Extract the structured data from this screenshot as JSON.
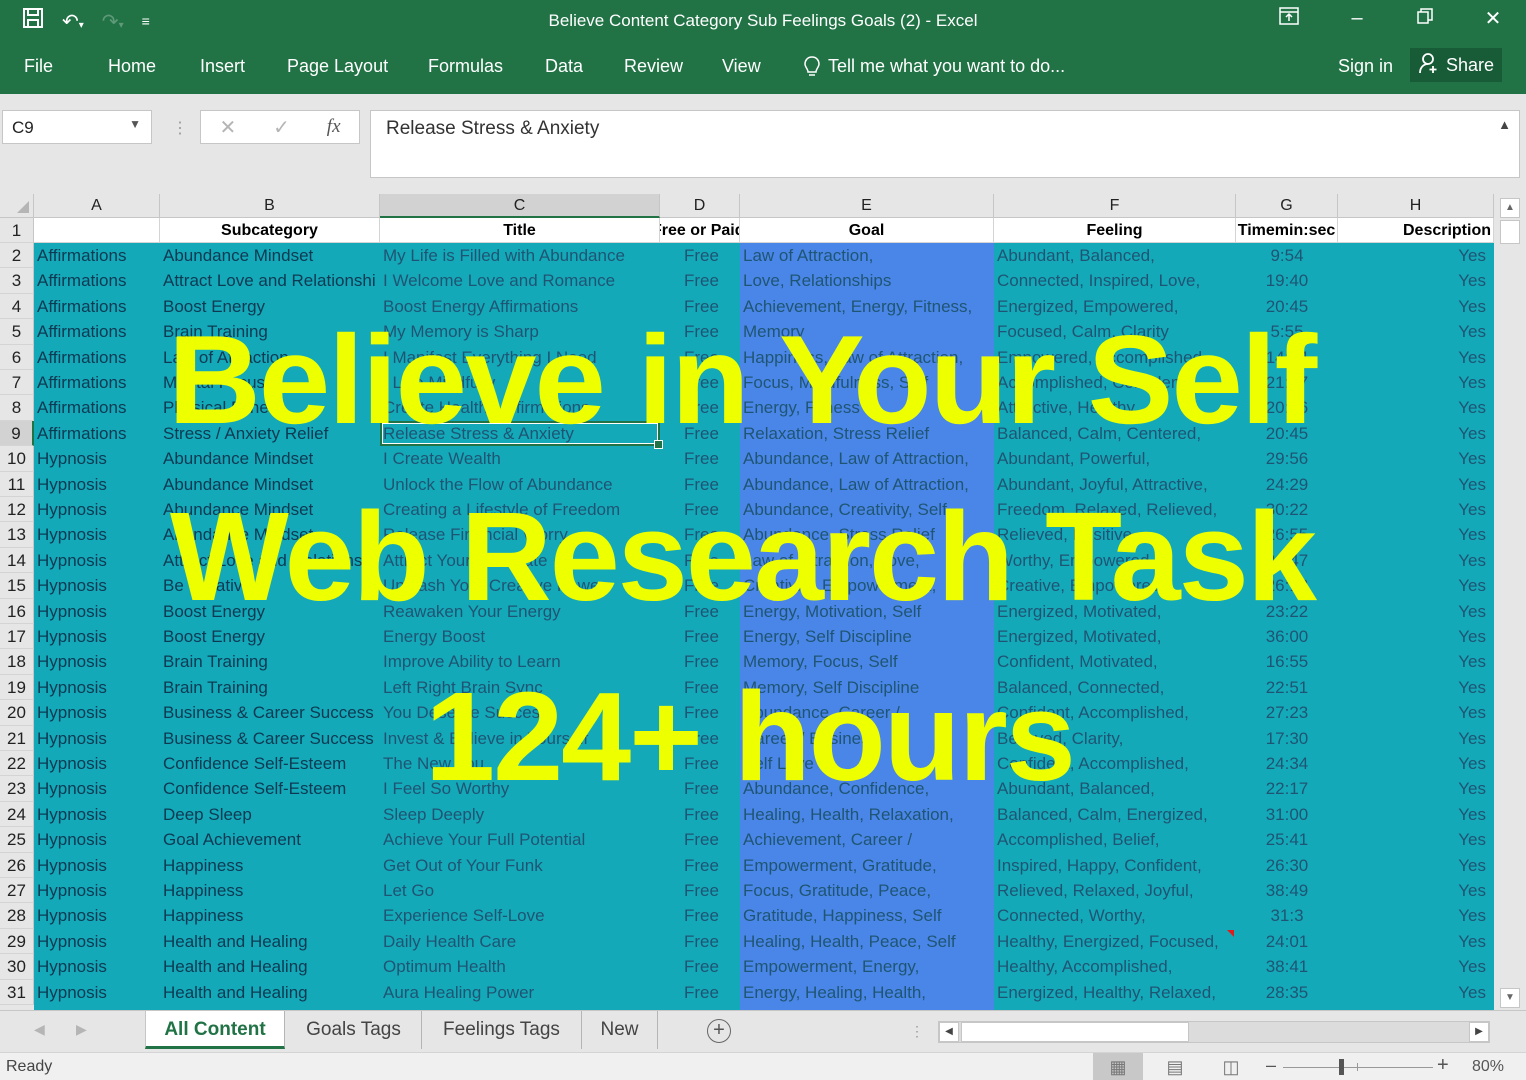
{
  "window": {
    "title": "Believe Content Category Sub Feelings Goals (2) - Excel",
    "qat_icons": [
      "save-icon",
      "undo-icon",
      "redo-icon",
      "customize-qat-icon"
    ],
    "controls": [
      "ribbon-display-options-icon",
      "minimize-icon",
      "restore-icon",
      "close-icon"
    ]
  },
  "ribbon": {
    "tabs": [
      "File",
      "Home",
      "Insert",
      "Page Layout",
      "Formulas",
      "Data",
      "Review",
      "View"
    ],
    "tell_me": "Tell me what you want to do...",
    "sign_in": "Sign in",
    "share": "Share"
  },
  "formula_bar": {
    "name_box": "C9",
    "cancel": "✕",
    "enter": "✓",
    "fx": "fx",
    "value": "Release Stress & Anxiety"
  },
  "sheet": {
    "columns": [
      "A",
      "B",
      "C",
      "D",
      "E",
      "F",
      "G",
      "H"
    ],
    "selected_column": "C",
    "selected_row": 9,
    "headers": [
      "",
      "Subcategory",
      "Title",
      "Free or Paid",
      "Goal",
      "Feeling",
      "Timemin:sec",
      "Description"
    ],
    "rows": [
      {
        "n": "2",
        "a": "Affirmations",
        "b": "Abundance Mindset",
        "c": "My Life is Filled with Abundance",
        "d": "Free",
        "e": "Law of Attraction,",
        "f": "Abundant, Balanced,",
        "g": "9:54",
        "h": "Yes"
      },
      {
        "n": "3",
        "a": "Affirmations",
        "b": "Attract Love and Relationshi",
        "c": "I Welcome Love and Romance",
        "d": "Free",
        "e": "Love, Relationships",
        "f": "Connected, Inspired, Love,",
        "g": "19:40",
        "h": "Yes"
      },
      {
        "n": "4",
        "a": "Affirmations",
        "b": "Boost Energy",
        "c": "Boost Energy Affirmations",
        "d": "Free",
        "e": "Achievement, Energy, Fitness,",
        "f": "Energized,  Empowered,",
        "g": "20:45",
        "h": "Yes"
      },
      {
        "n": "5",
        "a": "Affirmations",
        "b": "Brain Training",
        "c": "My Memory is Sharp",
        "d": "Free",
        "e": "Memory",
        "f": "Focused, Calm, Clarity",
        "g": "5:55",
        "h": "Yes"
      },
      {
        "n": "6",
        "a": "Affirmations",
        "b": "Law of Attraction",
        "c": "I Manifest Everything I Need",
        "d": "Free",
        "e": "Happiness, Law of Attraction,",
        "f": "Empowered, Accomplished,",
        "g": "14:54",
        "h": "Yes"
      },
      {
        "n": "7",
        "a": "Affirmations",
        "b": "Mental Focus",
        "c": "I Live Mindfully",
        "d": "Free",
        "e": "Focus, Mindfulness, Self",
        "f": "Accomplished, Confident",
        "g": "21:07",
        "h": "Yes"
      },
      {
        "n": "8",
        "a": "Affirmations",
        "b": "Physical Fitness",
        "c": "Create Healthy Affirmations",
        "d": "Free",
        "e": "Energy, Fitness",
        "f": "Attractive, Healthy,",
        "g": "20:16",
        "h": "Yes"
      },
      {
        "n": "9",
        "a": "Affirmations",
        "b": "Stress / Anxiety Relief",
        "c": "Release Stress & Anxiety",
        "d": "Free",
        "e": "Relaxation, Stress Relief",
        "f": "Balanced, Calm, Centered,",
        "g": "20:45",
        "h": "Yes"
      },
      {
        "n": "10",
        "a": "Hypnosis",
        "b": "Abundance Mindset",
        "c": "I Create Wealth",
        "d": "Free",
        "e": "Abundance, Law of Attraction,",
        "f": "Abundant, Powerful,",
        "g": "29:56",
        "h": "Yes"
      },
      {
        "n": "11",
        "a": "Hypnosis",
        "b": "Abundance Mindset",
        "c": "Unlock the Flow of Abundance",
        "d": "Free",
        "e": "Abundance, Law of Attraction,",
        "f": "Abundant, Joyful, Attractive,",
        "g": "24:29",
        "h": "Yes"
      },
      {
        "n": "12",
        "a": "Hypnosis",
        "b": "Abundance Mindset",
        "c": "Creating a Lifestyle of Freedom",
        "d": "Free",
        "e": "Abundance, Creativity, Self",
        "f": "Freedom, Relaxed, Relieved,",
        "g": "30:22",
        "h": "Yes"
      },
      {
        "n": "13",
        "a": "Hypnosis",
        "b": "Abundance Mindset",
        "c": "Release Financial Worry",
        "d": "Free",
        "e": "Abundance, Stress Relief",
        "f": "Relieved, Positive,",
        "g": "26:55",
        "h": "Yes"
      },
      {
        "n": "14",
        "a": "Hypnosis",
        "b": "Attract Love and Relationshi",
        "c": "Attract Your Soulmate",
        "d": "Free",
        "e": "Law of Attraction, Love,",
        "f": "Worthy, Empowered,",
        "g": "26:47",
        "h": "Yes"
      },
      {
        "n": "15",
        "a": "Hypnosis",
        "b": "Be Creative",
        "c": "Unleash Your Creative Power",
        "d": "Free",
        "e": "Creativity, Empowerment,",
        "f": "Creative, Empowered,",
        "g": "26:13",
        "h": "Yes"
      },
      {
        "n": "16",
        "a": "Hypnosis",
        "b": "Boost Energy",
        "c": "Reawaken Your Energy",
        "d": "Free",
        "e": "Energy, Motivation, Self",
        "f": "Energized, Motivated,",
        "g": "23:22",
        "h": "Yes"
      },
      {
        "n": "17",
        "a": "Hypnosis",
        "b": "Boost Energy",
        "c": "Energy Boost",
        "d": "Free",
        "e": "Energy, Self Discipline",
        "f": "Energized, Motivated,",
        "g": "36:00",
        "h": "Yes"
      },
      {
        "n": "18",
        "a": "Hypnosis",
        "b": "Brain Training",
        "c": "Improve Ability to Learn",
        "d": "Free",
        "e": "Memory, Focus, Self",
        "f": "Confident, Motivated,",
        "g": "16:55",
        "h": "Yes"
      },
      {
        "n": "19",
        "a": "Hypnosis",
        "b": "Brain Training",
        "c": "Left Right Brain Sync",
        "d": "Free",
        "e": "Memory, Self Discipline",
        "f": "Balanced, Connected,",
        "g": "22:51",
        "h": "Yes"
      },
      {
        "n": "20",
        "a": "Hypnosis",
        "b": "Business & Career Success",
        "c": "You Deserve Success",
        "d": "Free",
        "e": "Abundance, Career /",
        "f": "Confident, Accomplished,",
        "g": "27:23",
        "h": "Yes"
      },
      {
        "n": "21",
        "a": "Hypnosis",
        "b": "Business & Career Success",
        "c": "Invest & Believe in Yourself",
        "d": "Free",
        "e": "Career / Business",
        "f": "Believed, Clarity,",
        "g": "17:30",
        "h": "Yes"
      },
      {
        "n": "22",
        "a": "Hypnosis",
        "b": "Confidence Self-Esteem",
        "c": "The New You",
        "d": "Free",
        "e": " Self Love",
        "f": "Confident, Accomplished,",
        "g": "24:34",
        "h": "Yes"
      },
      {
        "n": "23",
        "a": "Hypnosis",
        "b": "Confidence Self-Esteem",
        "c": "I Feel So Worthy",
        "d": "Free",
        "e": "Abundance, Confidence,",
        "f": "Abundant, Balanced,",
        "g": "22:17",
        "h": "Yes"
      },
      {
        "n": "24",
        "a": "Hypnosis",
        "b": "Deep Sleep",
        "c": "Sleep Deeply",
        "d": "Free",
        "e": "Healing, Health, Relaxation,",
        "f": "Balanced, Calm, Energized,",
        "g": "31:00",
        "h": "Yes"
      },
      {
        "n": "25",
        "a": "Hypnosis",
        "b": "Goal Achievement",
        "c": "Achieve Your Full Potential",
        "d": "Free",
        "e": "Achievement, Career /",
        "f": "Accomplished, Belief,",
        "g": "25:41",
        "h": "Yes"
      },
      {
        "n": "26",
        "a": "Hypnosis",
        "b": "Happiness",
        "c": "Get Out of Your Funk",
        "d": "Free",
        "e": "Empowerment, Gratitude,",
        "f": "Inspired, Happy, Confident,",
        "g": "26:30",
        "h": "Yes"
      },
      {
        "n": "27",
        "a": "Hypnosis",
        "b": "Happiness",
        "c": "Let Go",
        "d": "Free",
        "e": "Focus, Gratitude, Peace,",
        "f": "Relieved, Relaxed, Joyful,",
        "g": "38:49",
        "h": "Yes"
      },
      {
        "n": "28",
        "a": "Hypnosis",
        "b": "Happiness",
        "c": "Experience Self-Love",
        "d": "Free",
        "e": "Gratitude, Happiness, Self",
        "f": "Connected, Worthy,",
        "g": "31:3",
        "h": "Yes"
      },
      {
        "n": "29",
        "a": "Hypnosis",
        "b": "Health and Healing",
        "c": "Daily Health Care",
        "d": "Free",
        "e": "Healing, Health, Peace, Self",
        "f": "Healthy, Energized, Focused,",
        "g": "24:01",
        "h": "Yes"
      },
      {
        "n": "30",
        "a": "Hypnosis",
        "b": "Health and Healing",
        "c": "Optimum Health",
        "d": "Free",
        "e": "Empowerment, Energy,",
        "f": "Healthy, Accomplished,",
        "g": "38:41",
        "h": "Yes"
      },
      {
        "n": "31",
        "a": "Hypnosis",
        "b": "Health and Healing",
        "c": "Aura Healing Power",
        "d": "Free",
        "e": "Energy, Healing, Health,",
        "f": "Energized, Healthy, Relaxed,",
        "g": "28:35",
        "h": "Yes"
      }
    ]
  },
  "sheet_tabs": {
    "tabs": [
      "All Content",
      "Goals Tags",
      "Feelings Tags",
      "New"
    ],
    "active": "All Content",
    "add": "+"
  },
  "status_bar": {
    "status": "Ready",
    "zoom": "80%"
  },
  "overlay": {
    "line1": "Believe in Your Self",
    "line2": "Web Research Task",
    "line3": "124+ hours"
  },
  "colors": {
    "excel_green": "#217346",
    "teal_fill": "#14a9b9",
    "blue_fill": "#4a86e8",
    "overlay_yellow": "#eeff00"
  }
}
